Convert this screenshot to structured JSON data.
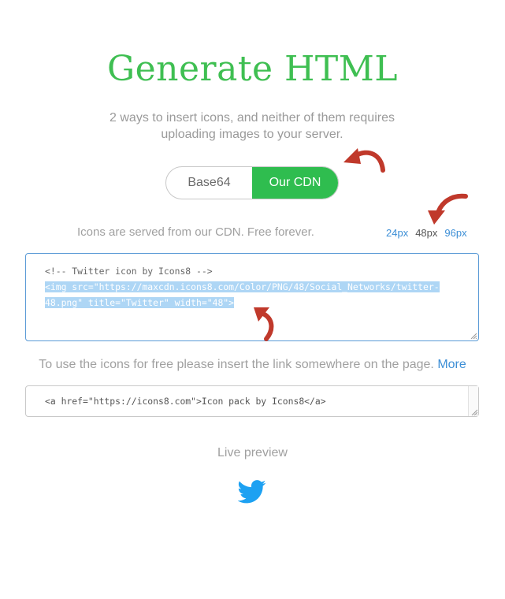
{
  "page": {
    "title": "Generate HTML",
    "subtitle": "2 ways to insert icons, and neither of them requires uploading images to your server."
  },
  "toggle": {
    "options": [
      "Base64",
      "Our CDN"
    ],
    "selected": "Our CDN"
  },
  "cdn_note": "Icons are served from our CDN. Free forever.",
  "sizes": {
    "options": [
      "24px",
      "48px",
      "96px"
    ],
    "selected": "48px"
  },
  "code": {
    "comment": "<!-- Twitter icon by Icons8 -->",
    "line1": "<img src=\"https://maxcdn.icons8.com/Color/PNG/48/Social_Networks/twitter-",
    "line2": "48.png\" title=\"Twitter\" width=\"48\">"
  },
  "free_note": {
    "text": "To use the icons for free please insert the link somewhere on the page. ",
    "more": "More"
  },
  "link_code": "<a href=\"https://icons8.com\">Icon pack by Icons8</a>",
  "preview": {
    "label": "Live preview",
    "icon": "twitter-bird-icon"
  },
  "colors": {
    "brand_green": "#3fbf52",
    "toggle_active": "#2fbd4f",
    "link_blue": "#3d8fd6",
    "arrow_red": "#c0392b",
    "twitter_blue": "#1da1f2",
    "selection": "#aed6f5"
  }
}
